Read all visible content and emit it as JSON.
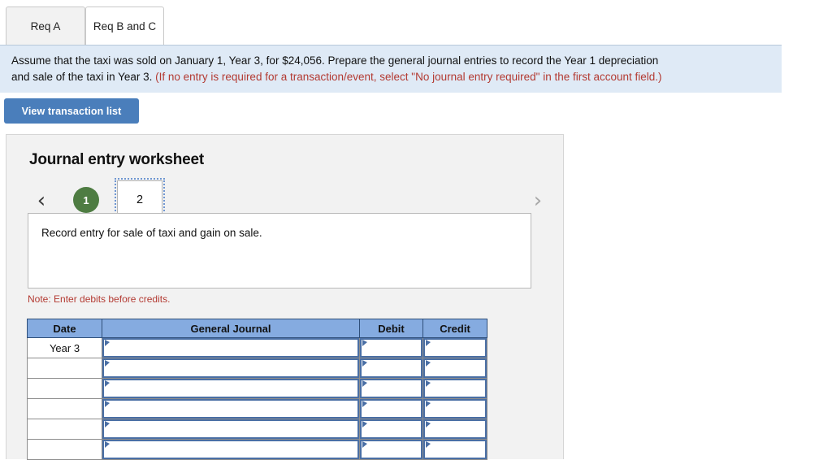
{
  "tabs": [
    {
      "id": "req-a",
      "label": "Req A",
      "active": false
    },
    {
      "id": "req-b-and-c",
      "label": "Req B and C",
      "active": true
    }
  ],
  "banner": {
    "line1": "Assume that the taxi was sold on January 1, Year 3, for $24,056. Prepare the general journal entries to record the Year 1 depreciation",
    "line2_black": "and sale of the taxi in Year 3. ",
    "line2_red": "(If no entry is required for a transaction/event, select \"No journal entry required\" in the first account field.)",
    "background_color": "#dfeaf6",
    "red_color": "#b33a32"
  },
  "toolbar": {
    "view_transaction_list_label": "View transaction list",
    "button_color": "#4a7ebb"
  },
  "worksheet": {
    "title": "Journal entry worksheet",
    "pager": {
      "prev_icon": "chevron-left-icon",
      "prev_glyph": "‹",
      "next_icon": "chevron-right-icon",
      "next_glyph": "›",
      "prev_enabled": true,
      "next_enabled": false,
      "steps": [
        {
          "label": "1",
          "state": "completed",
          "color": "#4e7c42"
        },
        {
          "label": "2",
          "state": "current",
          "color": "#6f96d1"
        }
      ]
    },
    "description": "Record entry for sale of taxi and gain on sale.",
    "note": "Note: Enter debits before credits.",
    "note_color": "#b33a32",
    "table": {
      "header_color": "#85abe0",
      "columns": [
        "Date",
        "General Journal",
        "Debit",
        "Credit"
      ],
      "rows": [
        {
          "date": "Year 3",
          "general_journal": "",
          "debit": "",
          "credit": ""
        },
        {
          "date": "",
          "general_journal": "",
          "debit": "",
          "credit": ""
        },
        {
          "date": "",
          "general_journal": "",
          "debit": "",
          "credit": ""
        },
        {
          "date": "",
          "general_journal": "",
          "debit": "",
          "credit": ""
        },
        {
          "date": "",
          "general_journal": "",
          "debit": "",
          "credit": ""
        },
        {
          "date": "",
          "general_journal": "",
          "debit": "",
          "credit": ""
        }
      ]
    }
  }
}
